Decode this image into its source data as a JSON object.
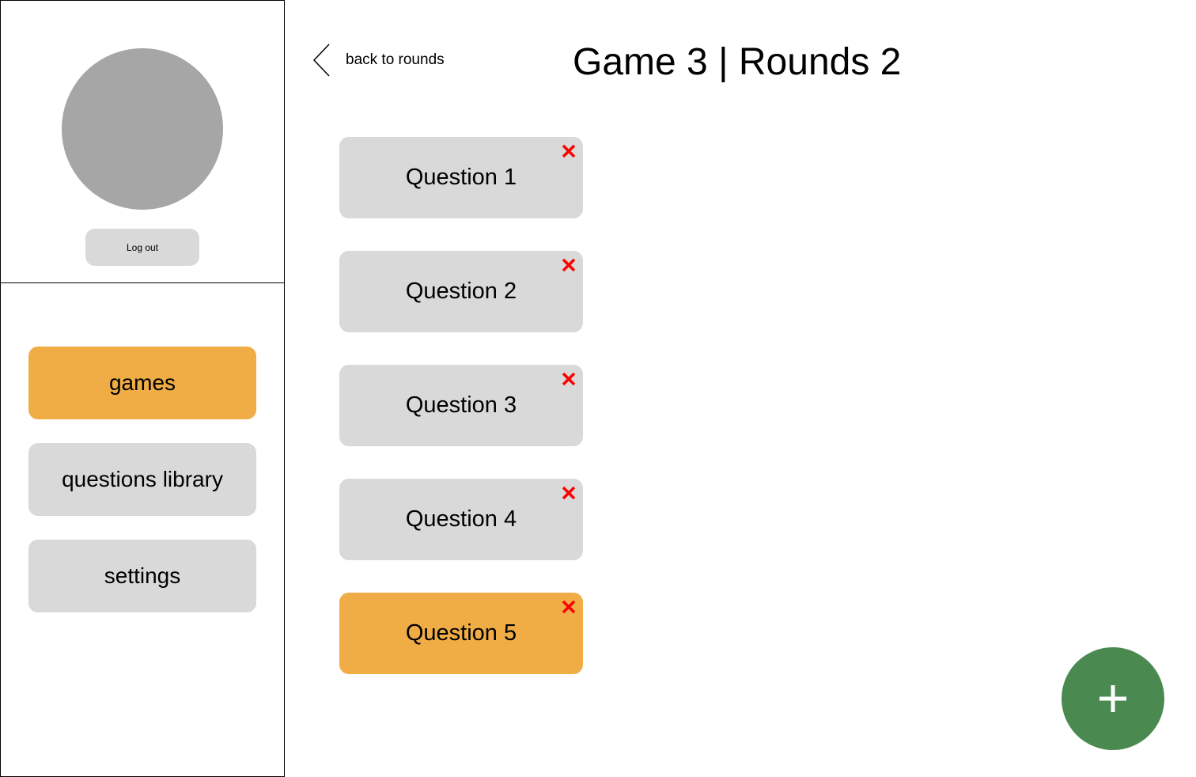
{
  "profile": {
    "logout_label": "Log out"
  },
  "nav": {
    "items": [
      {
        "label": "games",
        "active": true
      },
      {
        "label": "questions library",
        "active": false
      },
      {
        "label": "settings",
        "active": false
      }
    ]
  },
  "header": {
    "back_label": "back to rounds",
    "title": "Game 3 | Rounds 2"
  },
  "questions": [
    {
      "label": "Question 1",
      "selected": false
    },
    {
      "label": "Question 2",
      "selected": false
    },
    {
      "label": "Question 3",
      "selected": false
    },
    {
      "label": "Question 4",
      "selected": false
    },
    {
      "label": "Question 5",
      "selected": true
    }
  ],
  "icons": {
    "back": "chevron-left-icon",
    "delete": "close-icon",
    "add": "plus-icon"
  },
  "colors": {
    "accent": "#f0ad46",
    "neutral": "#d9d9d9",
    "avatar": "#a6a6a6",
    "delete": "#ff0000",
    "add_button": "#4a8a50"
  }
}
